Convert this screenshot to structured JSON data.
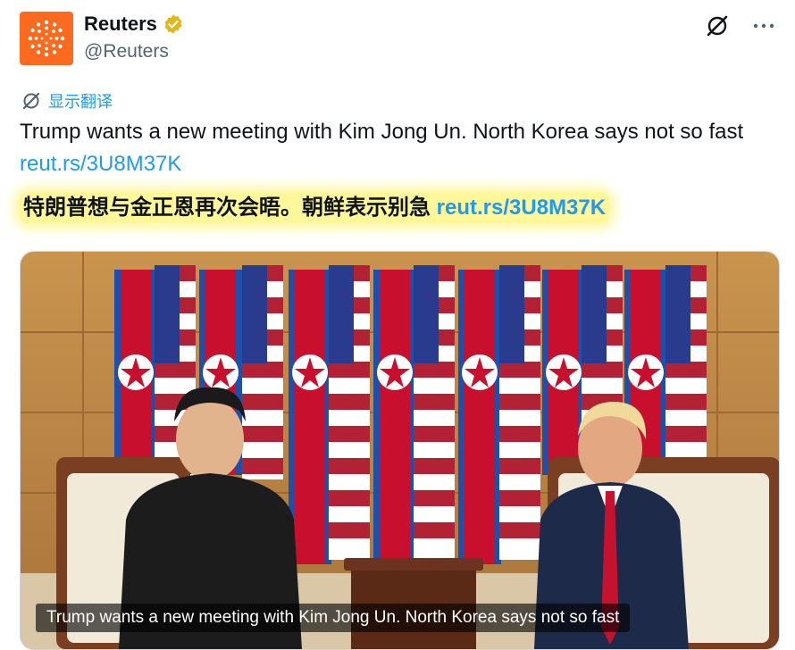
{
  "account": {
    "name": "Reuters",
    "handle": "@Reuters",
    "verified_icon": "verified-badge-icon",
    "avatar_icon": "reuters-logo-icon",
    "brand_color": "#fb6a1e"
  },
  "actions": {
    "grok_icon": "grok-icon",
    "more_icon": "more-icon"
  },
  "translate": {
    "label": "显示翻译",
    "icon": "translate-icon"
  },
  "tweet": {
    "text": "Trump wants a new meeting with Kim Jong Un. North Korea says not so fast",
    "link": "reut.rs/3U8M37K"
  },
  "translation": {
    "text": "特朗普想与金正恩再次会晤。朝鲜表示别急",
    "link": "reut.rs/3U8M37K",
    "highlight_color": "#fff79a"
  },
  "media": {
    "caption": "Trump wants a new meeting with Kim Jong Un. North Korea says not so fast"
  },
  "colors": {
    "link": "#1d9bf0",
    "text": "#0f1419",
    "secondary": "#536471"
  }
}
